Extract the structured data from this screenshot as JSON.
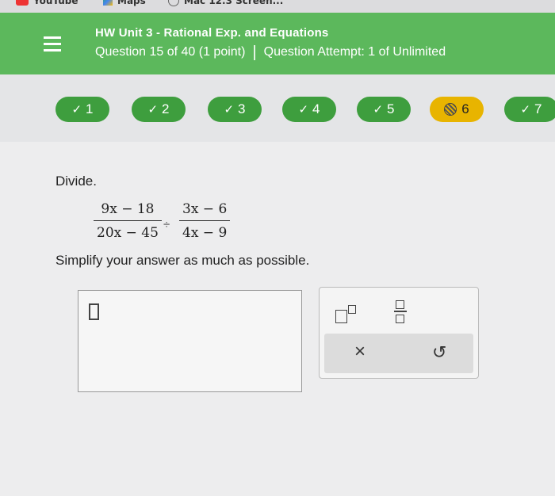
{
  "bookmarks": [
    {
      "label": "YouTube",
      "icon": "youtube-icon"
    },
    {
      "label": "Maps",
      "icon": "maps-icon"
    },
    {
      "label": "Mac 12.3 Screen...",
      "icon": "circle-icon"
    }
  ],
  "header": {
    "title": "HW Unit 3 - Rational Exp. and Equations",
    "question_info": "Question 15 of 40 (1 point)",
    "attempt_info": "Question Attempt: 1 of Unlimited"
  },
  "question_nav": [
    {
      "number": "1",
      "status": "correct"
    },
    {
      "number": "2",
      "status": "correct"
    },
    {
      "number": "3",
      "status": "correct"
    },
    {
      "number": "4",
      "status": "correct"
    },
    {
      "number": "5",
      "status": "correct"
    },
    {
      "number": "6",
      "status": "current"
    },
    {
      "number": "7",
      "status": "correct"
    }
  ],
  "problem": {
    "prompt": "Divide.",
    "fraction1": {
      "numerator": "9x − 18",
      "denominator": "20x − 45"
    },
    "operator": "÷",
    "fraction2": {
      "numerator": "3x − 6",
      "denominator": "4x − 9"
    },
    "instruction": "Simplify your answer as much as possible."
  },
  "tools": {
    "clear": "×",
    "undo": "↺"
  },
  "colors": {
    "header_green": "#5cb85c",
    "correct_green": "#3e9e3e",
    "current_yellow": "#e8b400"
  }
}
